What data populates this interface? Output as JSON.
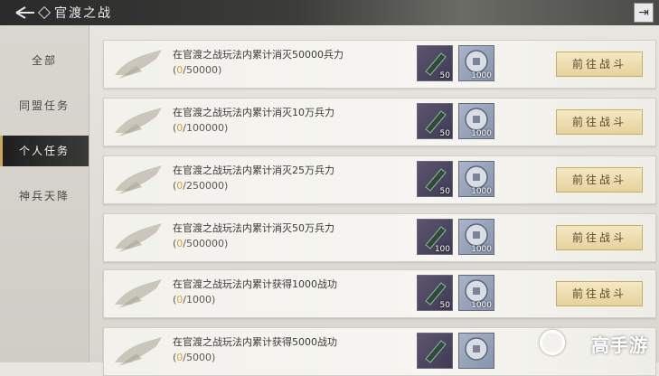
{
  "header": {
    "title": "官渡之战"
  },
  "sidebar": {
    "items": [
      {
        "label": "全部"
      },
      {
        "label": "同盟任务"
      },
      {
        "label": "个人任务",
        "active": true
      },
      {
        "label": "神兵天降"
      }
    ]
  },
  "tasks": [
    {
      "desc": "在官渡之战玩法内累计消灭50000兵力",
      "cur": "0",
      "total": "/50000)",
      "open": "(",
      "reward1": "50",
      "reward2": "1000",
      "button": "前往战斗"
    },
    {
      "desc": "在官渡之战玩法内累计消灭10万兵力",
      "cur": "0",
      "total": "/100000)",
      "open": "(",
      "reward1": "50",
      "reward2": "1000",
      "button": "前往战斗"
    },
    {
      "desc": "在官渡之战玩法内累计消灭25万兵力",
      "cur": "0",
      "total": "/250000)",
      "open": "(",
      "reward1": "50",
      "reward2": "1000",
      "button": "前往战斗"
    },
    {
      "desc": "在官渡之战玩法内累计消灭50万兵力",
      "cur": "0",
      "total": "/500000)",
      "open": "(",
      "reward1": "100",
      "reward2": "1000",
      "button": "前往战斗"
    },
    {
      "desc": "在官渡之战玩法内累计获得1000战功",
      "cur": "0",
      "total": "/1000)",
      "open": "(",
      "reward1": "50",
      "reward2": "1000",
      "button": "前往战斗"
    },
    {
      "desc": "在官渡之战玩法内累计获得5000战功",
      "cur": "0",
      "total": "/5000)",
      "open": "(",
      "reward1": "",
      "reward2": "",
      "button": ""
    }
  ],
  "watermark": {
    "text": "高手游"
  },
  "colors": {
    "accent_gold": "#d4a83a",
    "button_bg": "#eddcae",
    "active_tab": "#2a2a28"
  },
  "icons": {
    "back": "back-arrow-icon",
    "close": "exit-icon",
    "reward1": "scroll-token-icon",
    "reward2": "silver-coin-icon"
  }
}
